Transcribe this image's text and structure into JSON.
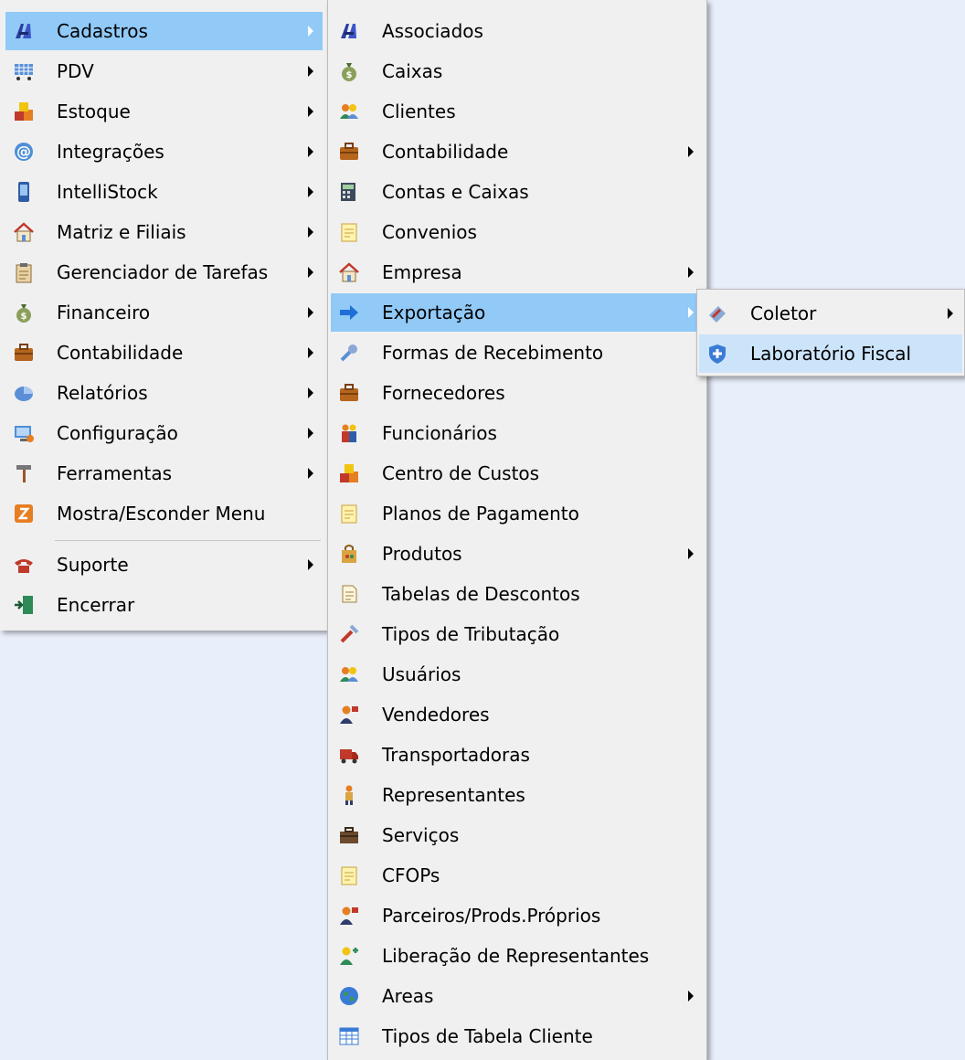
{
  "main_menu": {
    "items": [
      {
        "label": "Cadastros",
        "icon": "binoculars-icon",
        "submenu": true,
        "highlighted": true
      },
      {
        "label": "PDV",
        "icon": "cart-icon",
        "submenu": true
      },
      {
        "label": "Estoque",
        "icon": "boxes-icon",
        "submenu": true
      },
      {
        "label": "Integrações",
        "icon": "at-sign-icon",
        "submenu": true
      },
      {
        "label": "IntelliStock",
        "icon": "device-icon",
        "submenu": true
      },
      {
        "label": "Matriz e Filiais",
        "icon": "house-icon",
        "submenu": true
      },
      {
        "label": "Gerenciador de Tarefas",
        "icon": "clipboard-icon",
        "submenu": true
      },
      {
        "label": "Financeiro",
        "icon": "money-bag-icon",
        "submenu": true
      },
      {
        "label": "Contabilidade",
        "icon": "briefcase-icon",
        "submenu": true
      },
      {
        "label": "Relatórios",
        "icon": "pie-chart-icon",
        "submenu": true
      },
      {
        "label": "Configuração",
        "icon": "computer-settings-icon",
        "submenu": true
      },
      {
        "label": "Ferramentas",
        "icon": "hammer-icon",
        "submenu": true
      },
      {
        "label": "Mostra/Esconder Menu",
        "icon": "toggle-menu-icon",
        "submenu": false
      },
      {
        "label": "Suporte",
        "icon": "telephone-icon",
        "submenu": true
      },
      {
        "label": "Encerrar",
        "icon": "exit-door-icon",
        "submenu": false
      }
    ]
  },
  "cadastros_menu": {
    "items": [
      {
        "label": "Associados",
        "icon": "binoculars-icon",
        "submenu": false
      },
      {
        "label": "Caixas",
        "icon": "money-bag-icon",
        "submenu": false
      },
      {
        "label": "Clientes",
        "icon": "users-icon",
        "submenu": false
      },
      {
        "label": "Contabilidade",
        "icon": "briefcase-icon",
        "submenu": true
      },
      {
        "label": "Contas e Caixas",
        "icon": "calculator-icon",
        "submenu": false
      },
      {
        "label": "Convenios",
        "icon": "notepad-icon",
        "submenu": false
      },
      {
        "label": "Empresa",
        "icon": "house-icon",
        "submenu": true
      },
      {
        "label": "Exportação",
        "icon": "arrow-right-icon",
        "submenu": true,
        "highlighted": true
      },
      {
        "label": "Formas de Recebimento",
        "icon": "wrench-icon",
        "submenu": false
      },
      {
        "label": "Fornecedores",
        "icon": "briefcase-icon",
        "submenu": false
      },
      {
        "label": "Funcionários",
        "icon": "employees-icon",
        "submenu": false
      },
      {
        "label": "Centro de Custos",
        "icon": "boxes-icon",
        "submenu": false
      },
      {
        "label": "Planos de Pagamento",
        "icon": "notepad-icon",
        "submenu": false
      },
      {
        "label": "Produtos",
        "icon": "shopping-bag-icon",
        "submenu": true
      },
      {
        "label": "Tabelas de Descontos",
        "icon": "document-icon",
        "submenu": false
      },
      {
        "label": "Tipos de Tributação",
        "icon": "tools-icon",
        "submenu": false
      },
      {
        "label": "Usuários",
        "icon": "users-icon",
        "submenu": false
      },
      {
        "label": "Vendedores",
        "icon": "salesperson-icon",
        "submenu": false
      },
      {
        "label": "Transportadoras",
        "icon": "truck-icon",
        "submenu": false
      },
      {
        "label": "Representantes",
        "icon": "person-icon",
        "submenu": false
      },
      {
        "label": "Serviços",
        "icon": "toolbox-icon",
        "submenu": false
      },
      {
        "label": "CFOPs",
        "icon": "notepad-icon",
        "submenu": false
      },
      {
        "label": "Parceiros/Prods.Próprios",
        "icon": "salesperson-icon",
        "submenu": false
      },
      {
        "label": "Liberação de Representantes",
        "icon": "add-user-icon",
        "submenu": false
      },
      {
        "label": "Areas",
        "icon": "globe-icon",
        "submenu": true
      },
      {
        "label": "Tipos de Tabela Cliente",
        "icon": "table-icon",
        "submenu": false
      }
    ]
  },
  "exportacao_menu": {
    "items": [
      {
        "label": "Coletor",
        "icon": "scanner-icon",
        "submenu": true
      },
      {
        "label": "Laboratório Fiscal",
        "icon": "shield-icon",
        "submenu": false,
        "hovered": true
      }
    ]
  }
}
